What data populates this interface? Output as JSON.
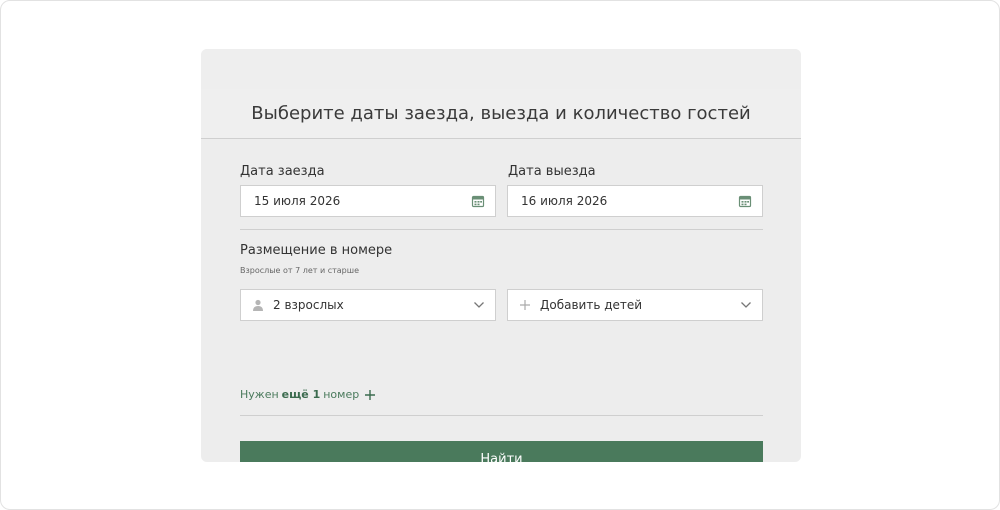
{
  "header": {
    "title": "Выберите даты заезда, выезда и количество гостей"
  },
  "checkin": {
    "label": "Дата заезда",
    "value": "15 июля 2026",
    "icon": "calendar-icon"
  },
  "checkout": {
    "label": "Дата выезда",
    "value": "16 июля 2026",
    "icon": "calendar-icon"
  },
  "accommodation": {
    "title": "Размещение в номере",
    "hint": "Взрослые от 7 лет и старше",
    "adults": {
      "value": "2 взрослых",
      "icon": "person-icon"
    },
    "children": {
      "value": "Добавить детей",
      "icon": "plus-icon"
    }
  },
  "more_rooms": {
    "prefix": "Нужен",
    "bold": "ещё 1",
    "suffix": "номер"
  },
  "submit": {
    "label": "Найти"
  },
  "colors": {
    "accent": "#4a7a5c",
    "card_bg": "#ededed",
    "border": "#cfcfcf"
  }
}
